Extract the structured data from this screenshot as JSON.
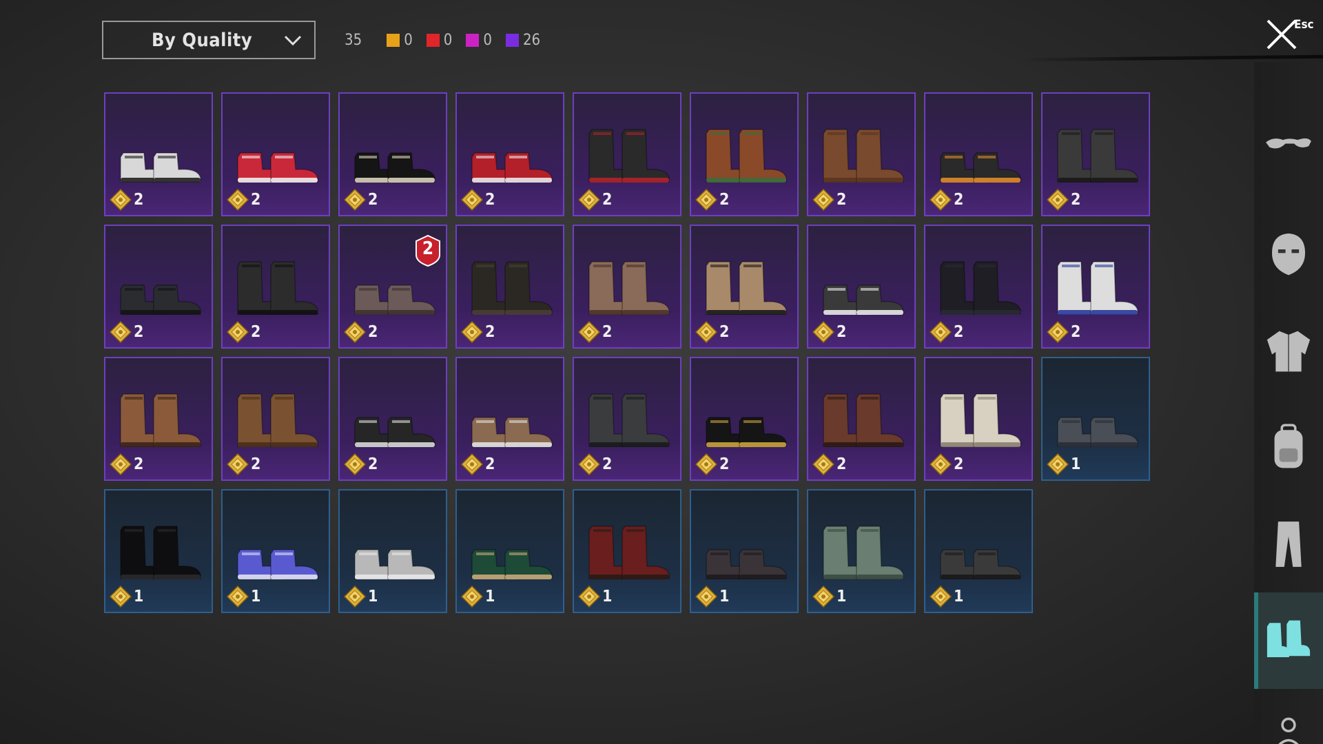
{
  "filter": {
    "sort_label": "By Quality"
  },
  "counts": {
    "total": "35",
    "legendary": {
      "color": "#e8a21a",
      "value": "0"
    },
    "mythic": {
      "color": "#e0262a",
      "value": "0"
    },
    "epic": {
      "color": "#cc22c4",
      "value": "0"
    },
    "rare": {
      "color": "#7a2de0",
      "value": "26"
    }
  },
  "close": {
    "label": "Esc"
  },
  "inventory": {
    "items": [
      {
        "cost": "2",
        "quality": "purple",
        "icon": "sneakers-icon"
      },
      {
        "cost": "2",
        "quality": "purple",
        "icon": "red-sneakers-icon"
      },
      {
        "cost": "2",
        "quality": "purple",
        "icon": "black-hightop-icon"
      },
      {
        "cost": "2",
        "quality": "purple",
        "icon": "red-hightop-icon"
      },
      {
        "cost": "2",
        "quality": "purple",
        "icon": "red-boots-icon"
      },
      {
        "cost": "2",
        "quality": "purple",
        "icon": "patterned-boots-icon"
      },
      {
        "cost": "2",
        "quality": "purple",
        "icon": "brown-tall-boots-icon"
      },
      {
        "cost": "2",
        "quality": "purple",
        "icon": "orange-sole-sneakers-icon"
      },
      {
        "cost": "2",
        "quality": "purple",
        "icon": "black-studded-boots-icon"
      },
      {
        "cost": "2",
        "quality": "purple",
        "icon": "black-loafers-icon"
      },
      {
        "cost": "2",
        "quality": "purple",
        "icon": "black-combat-boots-icon"
      },
      {
        "cost": "2",
        "quality": "purple",
        "icon": "brown-slip-on-icon",
        "badge": "2"
      },
      {
        "cost": "2",
        "quality": "purple",
        "icon": "dark-tall-boots-icon"
      },
      {
        "cost": "2",
        "quality": "purple",
        "icon": "brown-lace-boots-icon"
      },
      {
        "cost": "2",
        "quality": "purple",
        "icon": "fur-boots-icon"
      },
      {
        "cost": "2",
        "quality": "purple",
        "icon": "canvas-sneakers-icon"
      },
      {
        "cost": "2",
        "quality": "purple",
        "icon": "black-knee-boots-icon"
      },
      {
        "cost": "2",
        "quality": "purple",
        "icon": "blue-stripe-boots-icon"
      },
      {
        "cost": "2",
        "quality": "purple",
        "icon": "tan-lace-boots-icon"
      },
      {
        "cost": "2",
        "quality": "purple",
        "icon": "buckle-boots-icon"
      },
      {
        "cost": "2",
        "quality": "purple",
        "icon": "black-trainers-icon"
      },
      {
        "cost": "2",
        "quality": "purple",
        "icon": "brown-dress-shoes-icon"
      },
      {
        "cost": "2",
        "quality": "purple",
        "icon": "grey-cuff-boots-icon"
      },
      {
        "cost": "2",
        "quality": "purple",
        "icon": "gold-accent-trainers-icon"
      },
      {
        "cost": "2",
        "quality": "purple",
        "icon": "brown-work-boots-icon"
      },
      {
        "cost": "2",
        "quality": "purple",
        "icon": "white-boots-icon"
      },
      {
        "cost": "1",
        "quality": "blue",
        "icon": "grey-shoes-icon"
      },
      {
        "cost": "1",
        "quality": "blue",
        "icon": "black-tall-boots-icon"
      },
      {
        "cost": "1",
        "quality": "blue",
        "icon": "blue-sneakers-icon"
      },
      {
        "cost": "1",
        "quality": "blue",
        "icon": "white-slip-on-icon"
      },
      {
        "cost": "1",
        "quality": "blue",
        "icon": "green-sneakers-icon"
      },
      {
        "cost": "1",
        "quality": "blue",
        "icon": "red-leather-boots-icon"
      },
      {
        "cost": "1",
        "quality": "blue",
        "icon": "dark-loafers-icon"
      },
      {
        "cost": "1",
        "quality": "blue",
        "icon": "green-boots-icon"
      },
      {
        "cost": "1",
        "quality": "blue",
        "icon": "dark-oxfords-icon"
      }
    ]
  },
  "categories": [
    {
      "name": "eyewear-icon",
      "active": false
    },
    {
      "name": "mask-icon",
      "active": false
    },
    {
      "name": "jacket-icon",
      "active": false
    },
    {
      "name": "backpack-icon",
      "active": false
    },
    {
      "name": "pants-icon",
      "active": false
    },
    {
      "name": "shoes-icon",
      "active": true
    },
    {
      "name": "character-icon",
      "active": false
    }
  ]
}
